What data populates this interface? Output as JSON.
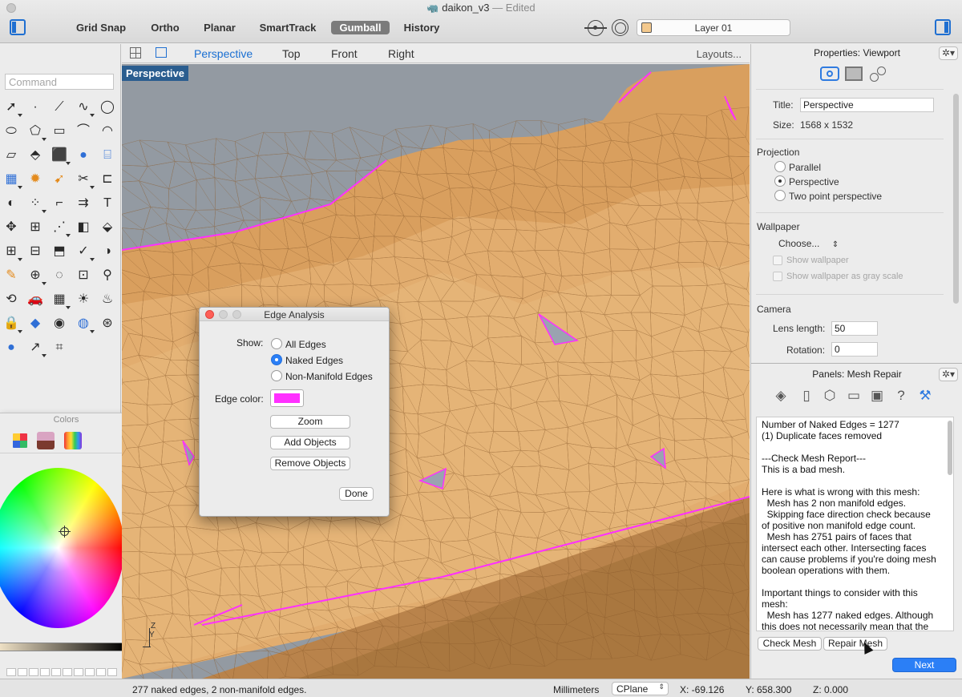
{
  "window": {
    "doc_title": "daikon_v3",
    "separator": "—",
    "doc_status": "Edited"
  },
  "toolbar": {
    "modes": [
      {
        "label": "Grid Snap",
        "active": false
      },
      {
        "label": "Ortho",
        "active": false
      },
      {
        "label": "Planar",
        "active": false
      },
      {
        "label": "SmartTrack",
        "active": false
      },
      {
        "label": "Gumball",
        "active": true
      },
      {
        "label": "History",
        "active": false
      }
    ],
    "layer": {
      "name": "Layer 01",
      "swatch_color": "#f3c98e"
    }
  },
  "command": {
    "placeholder": "Command"
  },
  "tools": [
    "arrow-select",
    "point",
    "polyline",
    "curve",
    "circle",
    "ellipse",
    "polygon",
    "rectangle",
    "freeform",
    "arc",
    "surface",
    "extrude-surface",
    "box",
    "sphere",
    "cylinder",
    "mesh",
    "explode",
    "sweep",
    "trim",
    "join",
    "fillet-solid",
    "group",
    "fillet-curve",
    "offset",
    "text",
    "move",
    "array",
    "edit-points",
    "boolean",
    "patch",
    "grid-array",
    "align",
    "extrude-curve",
    "check",
    "split",
    "paint",
    "zoom",
    "lasso",
    "zoom-window",
    "pan",
    "cplane",
    "car",
    "grid-plane",
    "sun",
    "light",
    "lock",
    "material",
    "render-color",
    "globe",
    "wireframe-sphere",
    "ball",
    "dimension",
    "snapshot"
  ],
  "colors_window": {
    "title": "Colors",
    "swatch_rows": 2,
    "swatch_cols": 10
  },
  "viewport": {
    "tabs": [
      "Perspective",
      "Top",
      "Front",
      "Right"
    ],
    "active_tab": "Perspective",
    "layouts_label": "Layouts...",
    "label": "Perspective",
    "axis_z": "Z",
    "axis_y": "Y",
    "mesh_color": "#dfaa6c",
    "edge_color": "#ff30ff",
    "sky_color": "#939aa2"
  },
  "edge_dialog": {
    "title": "Edge Analysis",
    "show_label": "Show:",
    "options": [
      {
        "label": "All Edges",
        "checked": false
      },
      {
        "label": "Naked Edges",
        "checked": true
      },
      {
        "label": "Non-Manifold Edges",
        "checked": false
      }
    ],
    "edge_color_label": "Edge color:",
    "edge_color_value": "#ff30ff",
    "buttons": [
      "Zoom",
      "Add Objects",
      "Remove Objects"
    ],
    "done_label": "Done"
  },
  "properties": {
    "title": "Properties: Viewport",
    "gear": "✲",
    "title_label": "Title:",
    "title_value": "Perspective",
    "size_label": "Size:",
    "size_value": "1568 x 1532",
    "projection_heading": "Projection",
    "projection_options": [
      {
        "label": "Parallel",
        "checked": false
      },
      {
        "label": "Perspective",
        "checked": true
      },
      {
        "label": "Two point perspective",
        "checked": false
      }
    ],
    "wallpaper_heading": "Wallpaper",
    "wallpaper_choose": "Choose...",
    "show_wallpaper": "Show wallpaper",
    "show_wallpaper_gray": "Show wallpaper as gray scale",
    "camera_heading": "Camera",
    "lens_label": "Lens length:",
    "lens_value": "50",
    "rotation_label": "Rotation:",
    "rotation_value": "0"
  },
  "mesh_repair": {
    "title": "Panels: Mesh Repair",
    "gear": "✲",
    "report": "Number of Naked Edges = 1277\n(1) Duplicate faces removed\n\n---Check Mesh Report---\nThis is a bad mesh.\n\nHere is what is wrong with this mesh:\n  Mesh has 2 non manifold edges.\n  Skipping face direction check because\nof positive non manifold edge count.\n  Mesh has 2751 pairs of faces that\nintersect each other. Intersecting faces\ncan cause problems if you're doing mesh\nboolean operations with them.\n\nImportant things to consider with this\nmesh:\n  Mesh has 1277 naked edges. Although\nthis does not necessarily mean that the",
    "check_button": "Check Mesh",
    "repair_button": "Repair Mesh",
    "next_button": "Next"
  },
  "statusbar": {
    "message": "277 naked edges, 2 non-manifold edges.",
    "units": "Millimeters",
    "cplane": "CPlane",
    "x": "X: -69.126",
    "y": "Y: 658.300",
    "z": "Z: 0.000"
  }
}
